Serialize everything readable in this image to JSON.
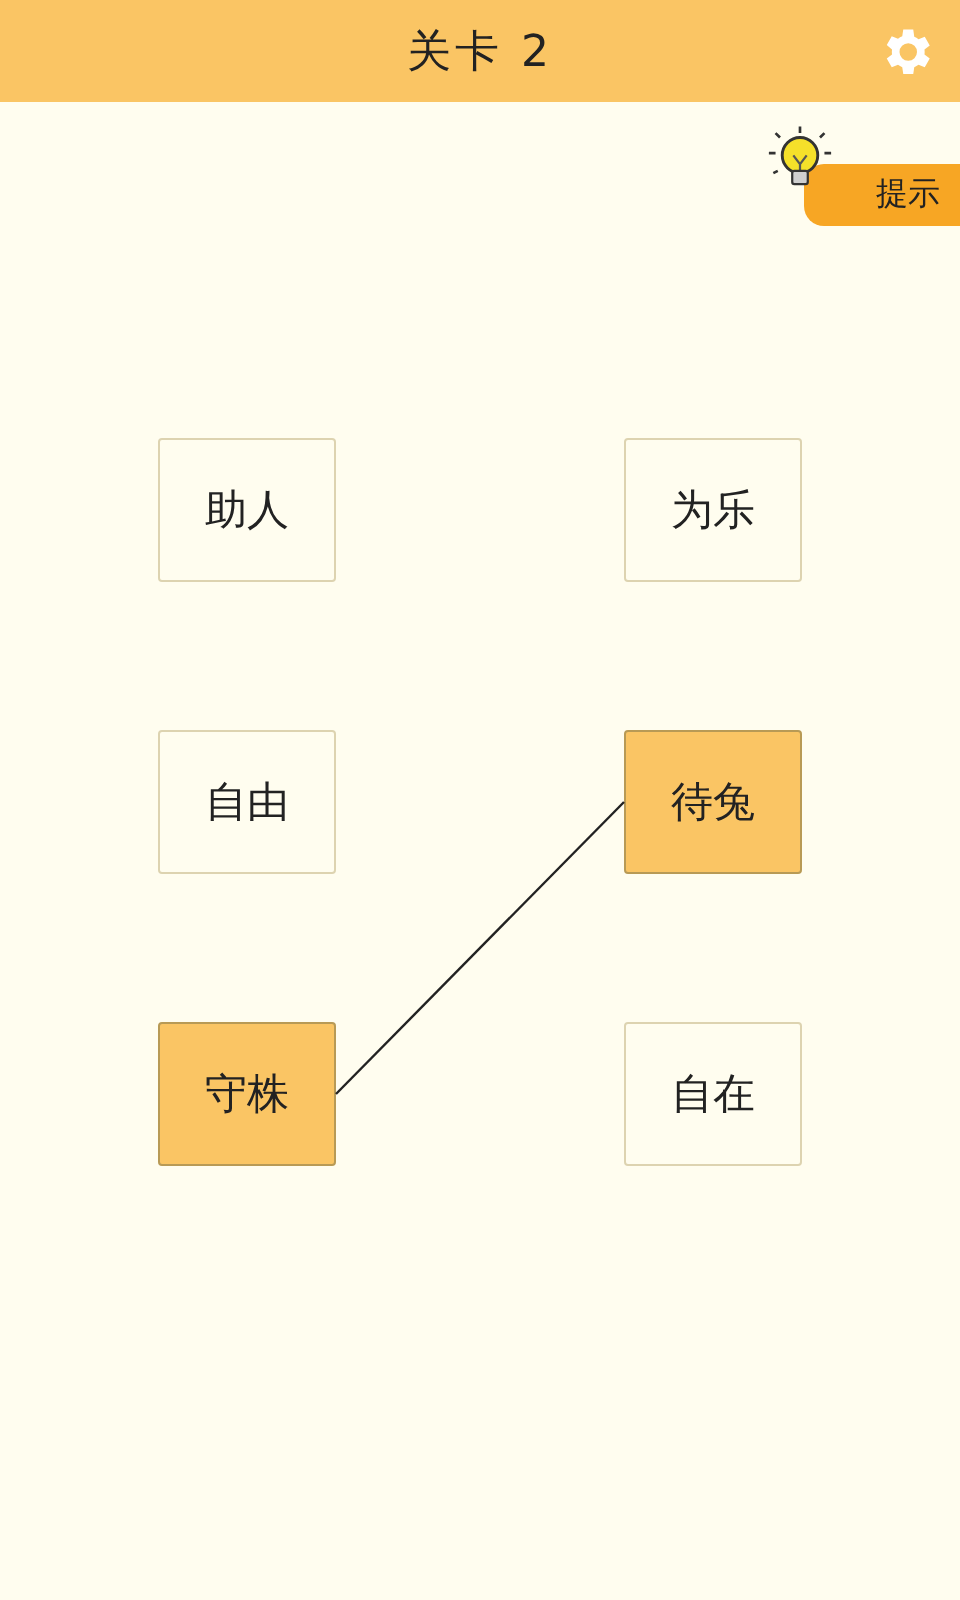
{
  "header": {
    "title": "关卡 2"
  },
  "hint": {
    "label": "提示"
  },
  "tiles": [
    {
      "text": "助人",
      "selected": false
    },
    {
      "text": "为乐",
      "selected": false
    },
    {
      "text": "自由",
      "selected": false
    },
    {
      "text": "待兔",
      "selected": true
    },
    {
      "text": "守株",
      "selected": true
    },
    {
      "text": "自在",
      "selected": false
    }
  ]
}
